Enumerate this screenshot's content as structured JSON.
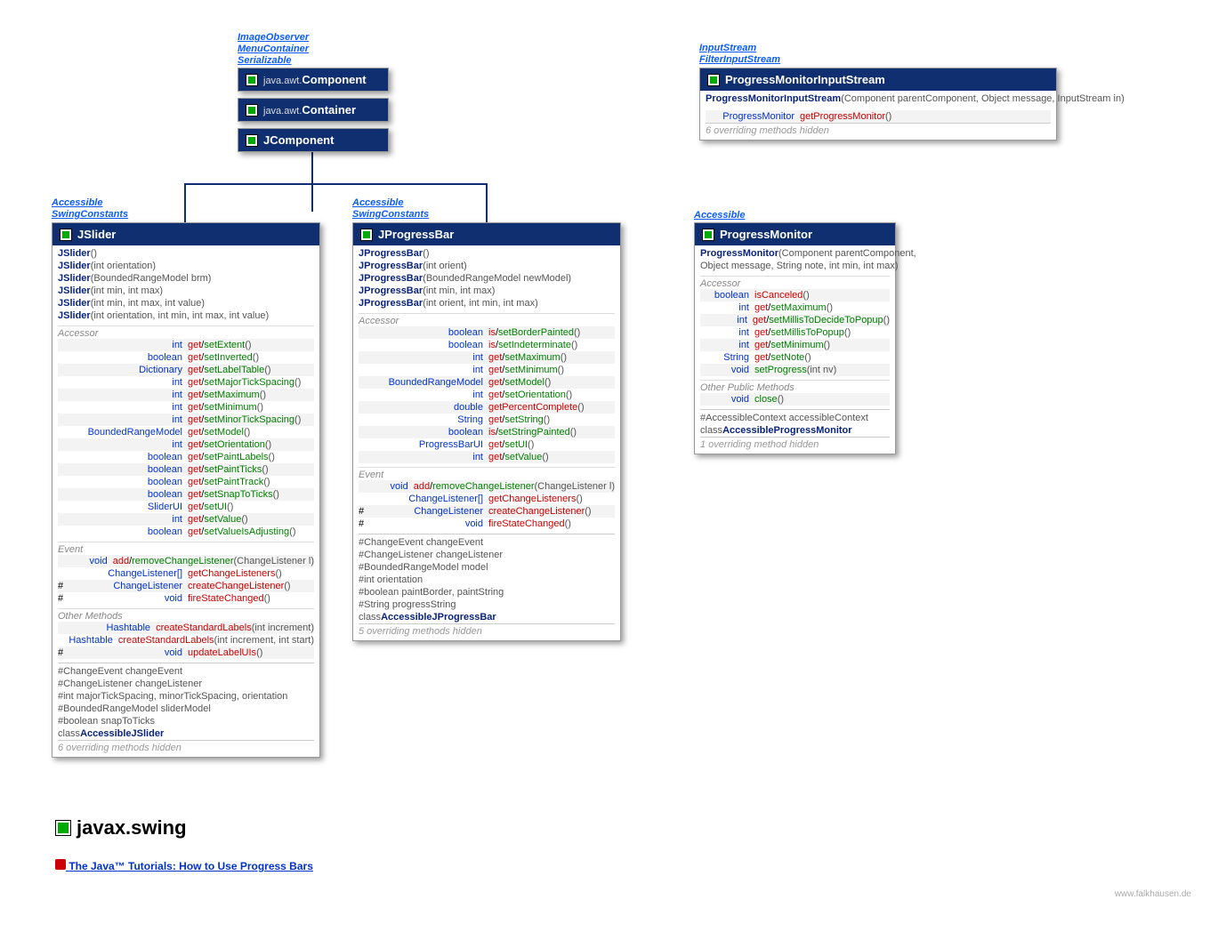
{
  "ifaces": {
    "top": [
      "ImageObserver",
      "MenuContainer",
      "Serializable"
    ],
    "jslider": [
      "Accessible",
      "SwingConstants"
    ],
    "jprog": [
      "Accessible",
      "SwingConstants"
    ],
    "pmon": [
      "Accessible"
    ],
    "pmis": [
      "InputStream",
      "FilterInputStream"
    ]
  },
  "hier": [
    {
      "pkg": "java.awt.",
      "name": "Component"
    },
    {
      "pkg": "java.awt.",
      "name": "Container"
    },
    {
      "pkg": "",
      "name": "JComponent"
    }
  ],
  "jslider": {
    "title": "JSlider",
    "ctors": [
      [
        "JSlider",
        "()"
      ],
      [
        "JSlider",
        "(int orientation)"
      ],
      [
        "JSlider",
        "(BoundedRangeModel brm)"
      ],
      [
        "JSlider",
        "(int min, int max)"
      ],
      [
        "JSlider",
        "(int min, int max, int value)"
      ],
      [
        "JSlider",
        "(int orientation, int min, int max, int value)"
      ]
    ],
    "acc": [
      [
        "",
        "int",
        "get/setExtent",
        "()"
      ],
      [
        "",
        "boolean",
        "get/setInverted",
        "()"
      ],
      [
        "",
        "Dictionary",
        "get/setLabelTable",
        "()"
      ],
      [
        "",
        "int",
        "get/setMajorTickSpacing",
        "()"
      ],
      [
        "",
        "int",
        "get/setMaximum",
        "()"
      ],
      [
        "",
        "int",
        "get/setMinimum",
        "()"
      ],
      [
        "",
        "int",
        "get/setMinorTickSpacing",
        "()"
      ],
      [
        "",
        "BoundedRangeModel",
        "get/setModel",
        "()"
      ],
      [
        "",
        "int",
        "get/setOrientation",
        "()"
      ],
      [
        "",
        "boolean",
        "get/setPaintLabels",
        "()"
      ],
      [
        "",
        "boolean",
        "get/setPaintTicks",
        "()"
      ],
      [
        "",
        "boolean",
        "get/setPaintTrack",
        "()"
      ],
      [
        "",
        "boolean",
        "get/setSnapToTicks",
        "()"
      ],
      [
        "",
        "SliderUI",
        "get/setUI",
        "()"
      ],
      [
        "",
        "int",
        "get/setValue",
        "()"
      ],
      [
        "",
        "boolean",
        "get/setValueIsAdjusting",
        "()"
      ]
    ],
    "evt": [
      [
        "",
        "void",
        "add/removeChangeListener",
        "(ChangeListener l)"
      ],
      [
        "",
        "ChangeListener[]",
        "getChangeListeners",
        "()"
      ],
      [
        "#",
        "ChangeListener",
        "createChangeListener",
        "()"
      ],
      [
        "#",
        "void",
        "fireStateChanged",
        "()"
      ]
    ],
    "other": [
      [
        "",
        "Hashtable",
        "createStandardLabels",
        "(int increment)"
      ],
      [
        "",
        "Hashtable",
        "createStandardLabels",
        "(int increment, int start)"
      ],
      [
        "#",
        "void",
        "updateLabelUIs",
        "()"
      ]
    ],
    "fields": [
      "#ChangeEvent changeEvent",
      "#ChangeListener changeListener",
      "#int majorTickSpacing, minorTickSpacing, orientation",
      "#BoundedRangeModel sliderModel",
      "#boolean snapToTicks"
    ],
    "inner": "AccessibleJSlider",
    "hidden": "6 overriding methods hidden"
  },
  "jprog": {
    "title": "JProgressBar",
    "ctors": [
      [
        "JProgressBar",
        "()"
      ],
      [
        "JProgressBar",
        "(int orient)"
      ],
      [
        "JProgressBar",
        "(BoundedRangeModel newModel)"
      ],
      [
        "JProgressBar",
        "(int min, int max)"
      ],
      [
        "JProgressBar",
        "(int orient, int min, int max)"
      ]
    ],
    "acc": [
      [
        "",
        "boolean",
        "is/setBorderPainted",
        "()"
      ],
      [
        "",
        "boolean",
        "is/setIndeterminate",
        "()"
      ],
      [
        "",
        "int",
        "get/setMaximum",
        "()"
      ],
      [
        "",
        "int",
        "get/setMinimum",
        "()"
      ],
      [
        "",
        "BoundedRangeModel",
        "get/setModel",
        "()"
      ],
      [
        "",
        "int",
        "get/setOrientation",
        "()"
      ],
      [
        "",
        "double",
        "getPercentComplete",
        "()"
      ],
      [
        "",
        "String",
        "get/setString",
        "()"
      ],
      [
        "",
        "boolean",
        "is/setStringPainted",
        "()"
      ],
      [
        "",
        "ProgressBarUI",
        "get/setUI",
        "()"
      ],
      [
        "",
        "int",
        "get/setValue",
        "()"
      ]
    ],
    "evt": [
      [
        "",
        "void",
        "add/removeChangeListener",
        "(ChangeListener l)"
      ],
      [
        "",
        "ChangeListener[]",
        "getChangeListeners",
        "()"
      ],
      [
        "#",
        "ChangeListener",
        "createChangeListener",
        "()"
      ],
      [
        "#",
        "void",
        "fireStateChanged",
        "()"
      ]
    ],
    "fields": [
      "#ChangeEvent changeEvent",
      "#ChangeListener changeListener",
      "#BoundedRangeModel model",
      "#int orientation",
      "#boolean paintBorder, paintString",
      "#String progressString"
    ],
    "inner": "AccessibleJProgressBar",
    "hidden": "5 overriding methods hidden"
  },
  "pmon": {
    "title": "ProgressMonitor",
    "ctors": [
      [
        "ProgressMonitor",
        "(Component parentComponent,"
      ],
      [
        "",
        "    Object message, String note, int min, int max)"
      ]
    ],
    "acc": [
      [
        "",
        "boolean",
        "isCanceled",
        "()"
      ],
      [
        "",
        "int",
        "get/setMaximum",
        "()"
      ],
      [
        "",
        "int",
        "get/setMillisToDecideToPopup",
        "()"
      ],
      [
        "",
        "int",
        "get/setMillisToPopup",
        "()"
      ],
      [
        "",
        "int",
        "get/setMinimum",
        "()"
      ],
      [
        "",
        "String",
        "get/setNote",
        "()"
      ],
      [
        "",
        "void",
        "setProgress",
        "(int nv)"
      ]
    ],
    "other": [
      [
        "",
        "void",
        "close",
        "()"
      ]
    ],
    "fields": [
      "#AccessibleContext accessibleContext"
    ],
    "inner": "AccessibleProgressMonitor",
    "hidden": "1 overriding method hidden"
  },
  "pmis": {
    "title": "ProgressMonitorInputStream",
    "ctors": [
      [
        "ProgressMonitorInputStream",
        "(Component parentComponent, Object message, InputStream in)"
      ]
    ],
    "methods": [
      [
        "",
        "ProgressMonitor",
        "getProgressMonitor",
        "()"
      ]
    ],
    "hidden": "6 overriding methods hidden"
  },
  "pkg": "javax.swing",
  "tutorial": "The Java™ Tutorials: How to Use Progress Bars",
  "footer": "www.falkhausen.de"
}
